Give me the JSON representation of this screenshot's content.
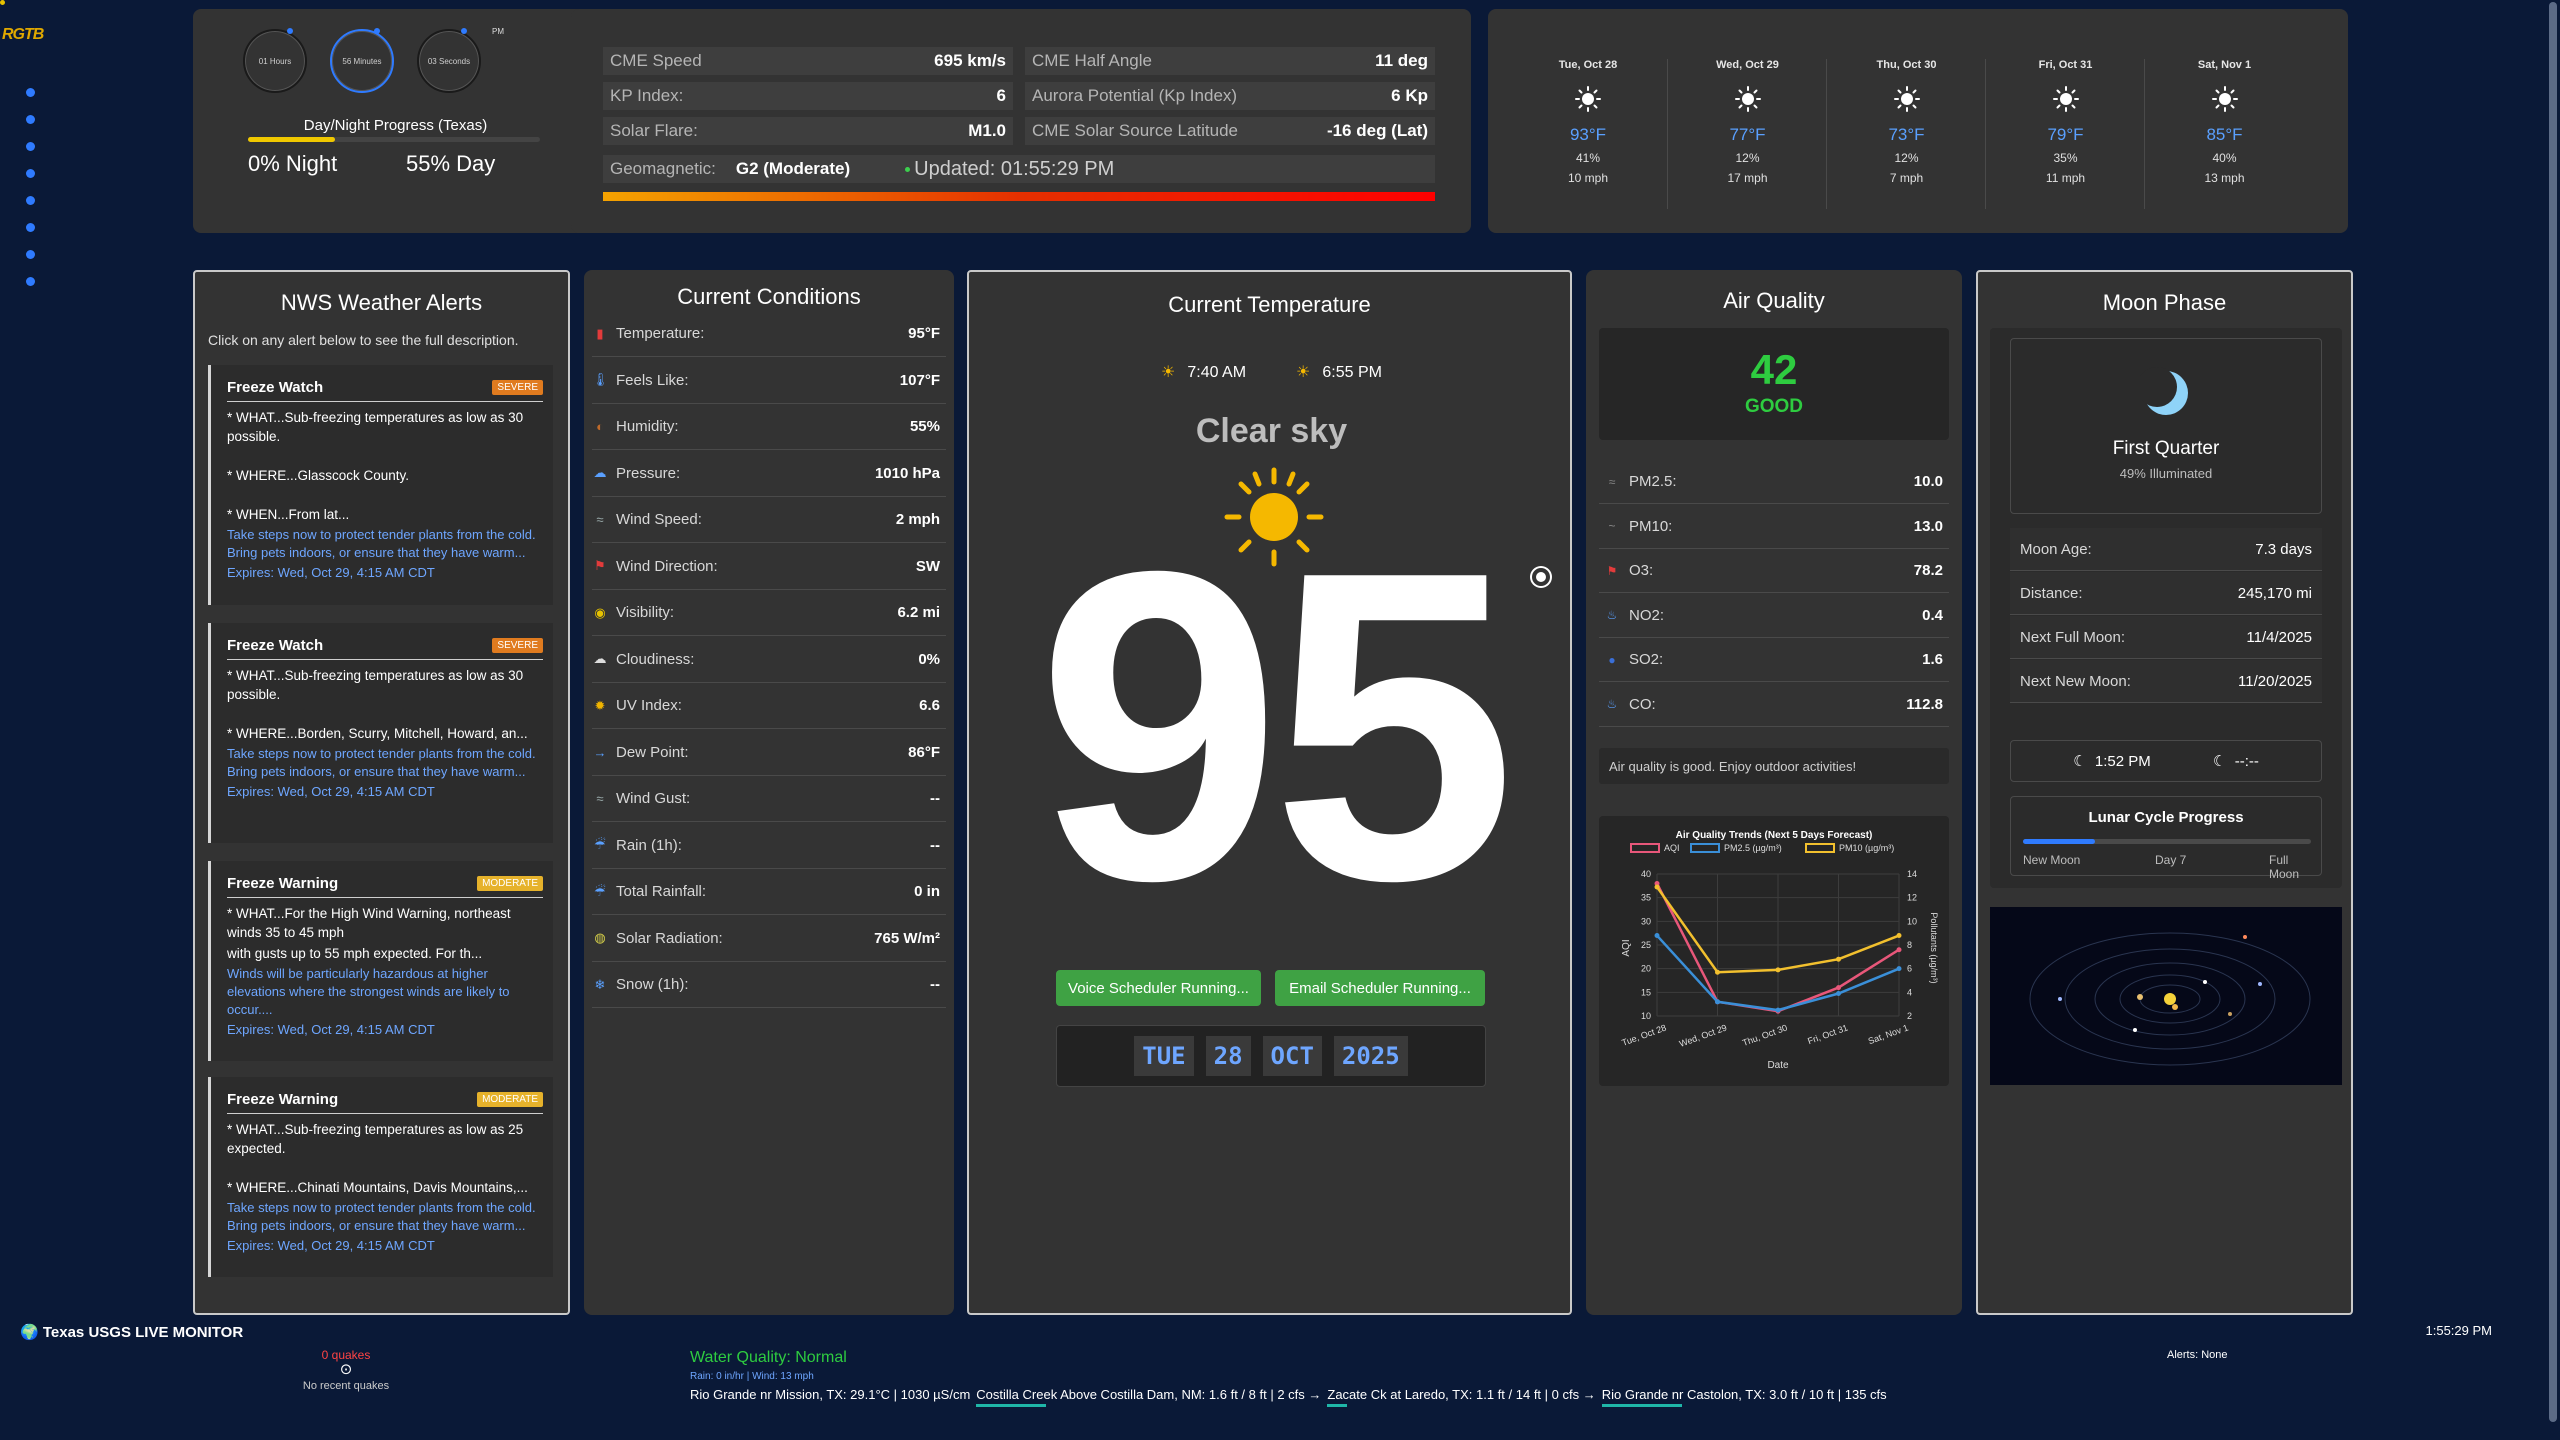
{
  "brand": {
    "logo_text": "RGTB"
  },
  "clock": {
    "hours_label": "01 Hours",
    "minutes_label": "56 Minutes",
    "seconds_label": "03 Seconds",
    "ampm": "PM",
    "daynight_title": "Day/Night Progress (Texas)",
    "night_text": "0% Night",
    "day_text": "55% Day",
    "day_progress": 0.55
  },
  "space_weather": {
    "cme_speed_label": "CME Speed",
    "cme_speed_value": "695 km/s",
    "cme_half_angle_label": "CME Half Angle",
    "cme_half_angle_value": "11 deg",
    "kp_label": "KP Index:",
    "kp_value": "6",
    "aurora_label": "Aurora Potential (Kp Index)",
    "aurora_value": "6 Kp",
    "flare_label": "Solar Flare:",
    "flare_value": "M1.0",
    "source_lat_label": "CME Solar Source Latitude",
    "source_lat_value": "-16 deg (Lat)",
    "geomag_label": "Geomagnetic:",
    "geomag_value": "G2 (Moderate)",
    "updated_text": "Updated: 01:55:29 PM"
  },
  "forecast": [
    {
      "date": "Tue, Oct 28",
      "icon": "sun-icon",
      "temp": "93°F",
      "precip": "41%",
      "wind": "10 mph"
    },
    {
      "date": "Wed, Oct 29",
      "icon": "sun-icon",
      "temp": "77°F",
      "precip": "12%",
      "wind": "17 mph"
    },
    {
      "date": "Thu, Oct 30",
      "icon": "sun-icon",
      "temp": "73°F",
      "precip": "12%",
      "wind": "7 mph"
    },
    {
      "date": "Fri, Oct 31",
      "icon": "sun-icon",
      "temp": "79°F",
      "precip": "35%",
      "wind": "11 mph"
    },
    {
      "date": "Sat, Nov 1",
      "icon": "sun-icon",
      "temp": "85°F",
      "precip": "40%",
      "wind": "13 mph"
    }
  ],
  "alerts": {
    "title": "NWS Weather Alerts",
    "intro": "Click on any alert below to see the full description.",
    "items": [
      {
        "name": "Freeze Watch",
        "severity": "SEVERE",
        "what": "* WHAT...Sub-freezing temperatures as low as 30 possible.",
        "where": "* WHERE...Glasscock County.",
        "when": "* WHEN...From lat...",
        "instr": "Take steps now to protect tender plants from the cold. Bring pets indoors, or ensure that they have warm...",
        "expires": "Expires: Wed, Oct 29, 4:15 AM CDT"
      },
      {
        "name": "Freeze Watch",
        "severity": "SEVERE",
        "what": "* WHAT...Sub-freezing temperatures as low as 30 possible.",
        "where": "* WHERE...Borden, Scurry, Mitchell, Howard, an...",
        "when": "",
        "instr": "Take steps now to protect tender plants from the cold. Bring pets indoors, or ensure that they have warm...",
        "expires": "Expires: Wed, Oct 29, 4:15 AM CDT"
      },
      {
        "name": "Freeze Warning",
        "severity": "MODERATE",
        "what": "* WHAT...For the High Wind Warning, northeast winds 35 to 45 mph",
        "where": "with gusts up to 55 mph expected. For th...",
        "when": "",
        "instr": "Winds will be particularly hazardous at higher elevations where the strongest winds are likely to occur....",
        "expires": "Expires: Wed, Oct 29, 4:15 AM CDT"
      },
      {
        "name": "Freeze Warning",
        "severity": "MODERATE",
        "what": "* WHAT...Sub-freezing temperatures as low as 25 expected.",
        "where": "* WHERE...Chinati Mountains, Davis Mountains,...",
        "when": "",
        "instr": "Take steps now to protect tender plants from the cold. Bring pets indoors, or ensure that they have warm...",
        "expires": "Expires: Wed, Oct 29, 4:15 AM CDT"
      }
    ]
  },
  "conditions": {
    "title": "Current Conditions",
    "rows": [
      {
        "label": "Temperature:",
        "value": "95°F",
        "icon": "thermometer-icon"
      },
      {
        "label": "Feels Like:",
        "value": "107°F",
        "icon": "feels-like-icon"
      },
      {
        "label": "Humidity:",
        "value": "55%",
        "icon": "humidity-icon"
      },
      {
        "label": "Pressure:",
        "value": "1010 hPa",
        "icon": "pressure-icon"
      },
      {
        "label": "Wind Speed:",
        "value": "2 mph",
        "icon": "wind-icon"
      },
      {
        "label": "Wind Direction:",
        "value": "SW",
        "icon": "wind-direction-icon"
      },
      {
        "label": "Visibility:",
        "value": "6.2 mi",
        "icon": "eye-icon"
      },
      {
        "label": "Cloudiness:",
        "value": "0%",
        "icon": "cloud-icon"
      },
      {
        "label": "UV Index:",
        "value": "6.6",
        "icon": "uv-icon"
      },
      {
        "label": "Dew Point:",
        "value": "86°F",
        "icon": "dew-point-icon"
      },
      {
        "label": "Wind Gust:",
        "value": "--",
        "icon": "wind-gust-icon"
      },
      {
        "label": "Rain (1h):",
        "value": "--",
        "icon": "rain-icon"
      },
      {
        "label": "Total Rainfall:",
        "value": "0 in",
        "icon": "rainfall-icon"
      },
      {
        "label": "Solar Radiation:",
        "value": "765 W/m²",
        "icon": "solar-radiation-icon"
      },
      {
        "label": "Snow (1h):",
        "value": "--",
        "icon": "snow-icon"
      }
    ]
  },
  "temperature": {
    "title": "Current Temperature",
    "sunrise": "7:40 AM",
    "sunset": "6:55 PM",
    "condition": "Clear sky",
    "value": "95",
    "voice_button": "Voice Scheduler Running...",
    "email_button": "Email Scheduler Running...",
    "date_dow": "TUE",
    "date_day": "28",
    "date_month": "OCT",
    "date_year": "2025"
  },
  "air_quality": {
    "title": "Air Quality",
    "aqi": "42",
    "category": "GOOD",
    "good_color": "#2ecc40",
    "rows": [
      {
        "label": "PM2.5:",
        "value": "10.0",
        "icon": "pm25-icon"
      },
      {
        "label": "PM10:",
        "value": "13.0",
        "icon": "pm10-icon"
      },
      {
        "label": "O3:",
        "value": "78.2",
        "icon": "ozone-icon"
      },
      {
        "label": "NO2:",
        "value": "0.4",
        "icon": "no2-icon"
      },
      {
        "label": "SO2:",
        "value": "1.6",
        "icon": "so2-icon"
      },
      {
        "label": "CO:",
        "value": "112.8",
        "icon": "co-icon"
      }
    ],
    "message": "Air quality is good. Enjoy outdoor activities!"
  },
  "chart_data": {
    "type": "line",
    "title": "Air Quality Trends (Next 5 Days Forecast)",
    "xlabel": "Date",
    "ylabel": "AQI",
    "y2label": "Pollutants (µg/m³)",
    "categories": [
      "Tue, Oct 28",
      "Wed, Oct 29",
      "Thu, Oct 30",
      "Fri, Oct 31",
      "Sat, Nov 1"
    ],
    "ylim": [
      10,
      40
    ],
    "y2lim": [
      2,
      14
    ],
    "yticks": [
      10,
      15,
      20,
      25,
      30,
      35,
      40
    ],
    "y2ticks": [
      2,
      4,
      6,
      8,
      10,
      12,
      14
    ],
    "legend_position": "top",
    "series": [
      {
        "name": "AQI",
        "axis": "left",
        "color": "#e8577a",
        "values": [
          38,
          13,
          11,
          16,
          24
        ]
      },
      {
        "name": "PM2.5 (µg/m³)",
        "axis": "right",
        "color": "#3a8fd8",
        "values": [
          8.8,
          3.2,
          2.5,
          3.9,
          6.0
        ]
      },
      {
        "name": "PM10 (µg/m³)",
        "axis": "right",
        "color": "#f2c02e",
        "values": [
          12.9,
          5.7,
          5.9,
          6.8,
          8.8
        ]
      }
    ]
  },
  "moon": {
    "title": "Moon Phase",
    "phase": "First Quarter",
    "illumination": "49% Illuminated",
    "age_label": "Moon Age:",
    "age_value": "7.3 days",
    "distance_label": "Distance:",
    "distance_value": "245,170 mi",
    "full_label": "Next Full Moon:",
    "full_value": "11/4/2025",
    "new_label": "Next New Moon:",
    "new_value": "11/20/2025",
    "moonrise": "1:52 PM",
    "moonset": "--:--",
    "cycle_title": "Lunar Cycle Progress",
    "cycle_start": "New Moon",
    "cycle_mid": "Day 7",
    "cycle_end": "Full Moon",
    "cycle_progress": 0.25
  },
  "usgs": {
    "title": "Texas USGS LIVE MONITOR",
    "quakes_count": "0 quakes",
    "quakes_none": "No recent quakes",
    "water_quality": "Water Quality: Normal",
    "rain_wind": "Rain: 0 in/hr | Wind: 13 mph",
    "alerts": "Alerts: None",
    "clock": "1:55:29 PM",
    "ticker": [
      "Rio Grande nr Mission, TX: 29.1°C | 1030 µS/cm",
      "Costilla Creek Above Costilla Dam, NM: 1.6 ft / 8 ft | 2 cfs →",
      "Zacate Ck at Laredo, TX: 1.1 ft / 14 ft | 0 cfs →",
      "Rio Grande nr Castolon, TX: 3.0 ft / 10 ft | 135 cfs"
    ]
  }
}
